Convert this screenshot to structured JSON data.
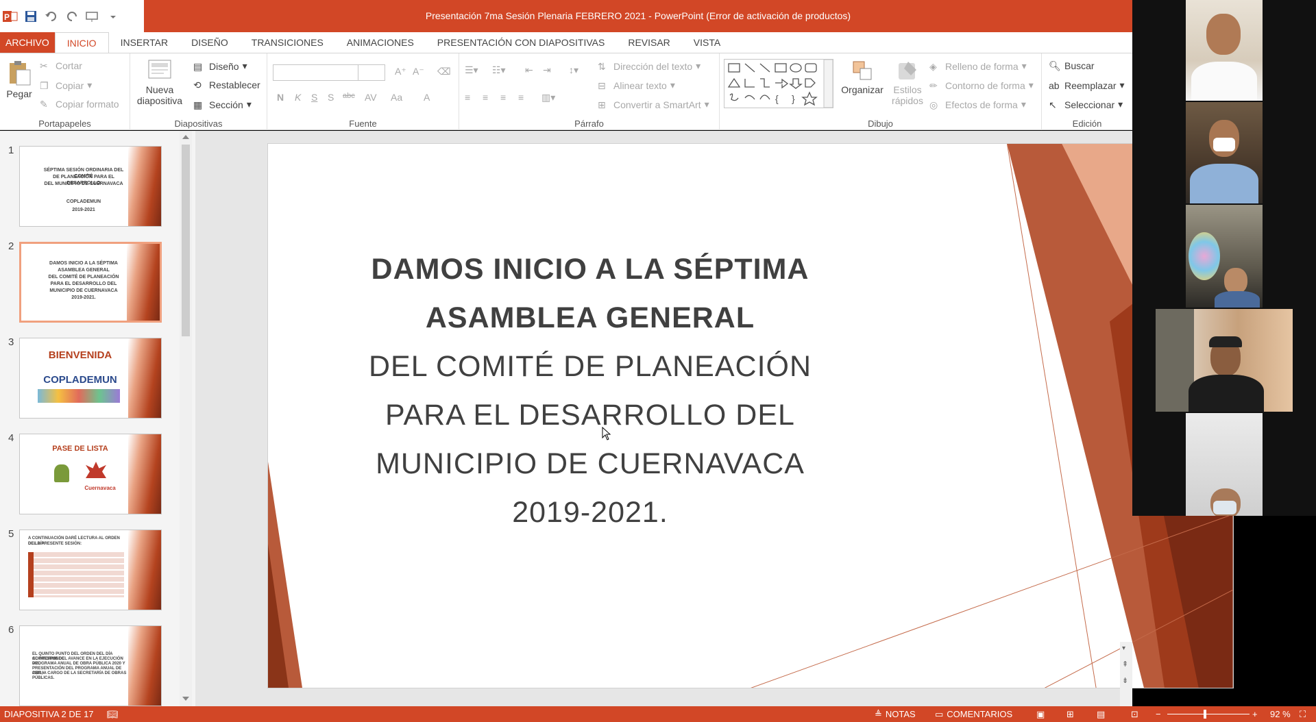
{
  "window": {
    "title": "Presentación 7ma Sesión Plenaria FEBRERO 2021 -  PowerPoint (Error de activación de productos)"
  },
  "tabs": [
    "ARCHIVO",
    "INICIO",
    "INSERTAR",
    "DISEÑO",
    "TRANSICIONES",
    "ANIMACIONES",
    "PRESENTACIÓN CON DIAPOSITIVAS",
    "REVISAR",
    "VISTA"
  ],
  "ribbon": {
    "clipboard": {
      "label": "Portapapeles",
      "paste": "Pegar",
      "cut": "Cortar",
      "copy": "Copiar",
      "format_painter": "Copiar formato"
    },
    "slides": {
      "label": "Diapositivas",
      "new_slide": "Nueva",
      "new_slide_2": "diapositiva",
      "layout": "Diseño",
      "reset": "Restablecer",
      "section": "Sección"
    },
    "font": {
      "label": "Fuente"
    },
    "paragraph": {
      "label": "Párrafo",
      "text_direction": "Dirección del texto",
      "align_text": "Alinear texto",
      "smartart": "Convertir a SmartArt"
    },
    "drawing": {
      "label": "Dibujo",
      "arrange": "Organizar",
      "quick_styles": "Estilos",
      "quick_styles_2": "rápidos",
      "shape_fill": "Relleno de forma",
      "shape_outline": "Contorno de forma",
      "shape_effects": "Efectos de forma"
    },
    "editing": {
      "label": "Edición",
      "find": "Buscar",
      "replace": "Reemplazar",
      "select": "Seleccionar"
    }
  },
  "thumbnails": [
    {
      "num": "1",
      "lines": [
        "SÉPTIMA SESIÓN ORDINARIA DEL COMITÉ",
        "DE PLANEACIÓN PARA EL DESARROLLO",
        "DEL MUNICIPIO DE CUERNAVACA",
        "",
        "COPLADEMUN",
        "2019-2021"
      ]
    },
    {
      "num": "2",
      "lines": [
        "DAMOS INICIO A LA SÉPTIMA",
        "ASAMBLEA GENERAL",
        "DEL COMITÉ DE PLANEACIÓN",
        "PARA EL DESARROLLO DEL",
        "MUNICIPIO DE CUERNAVACA",
        "2019-2021."
      ]
    },
    {
      "num": "3",
      "title": "BIENVENIDA",
      "logo": "COPLADEMUN"
    },
    {
      "num": "4",
      "title": "PASE DE LISTA",
      "logo": "Cuernavaca"
    },
    {
      "num": "5",
      "lines": [
        "A CONTINUACIÓN DARÉ LECTURA AL ORDEN DEL DÍA",
        "DE LA PRESENTE SESIÓN:"
      ]
    },
    {
      "num": "6",
      "lines": [
        "EL QUINTO PUNTO DEL ORDEN DEL DÍA CORRESPONDE",
        "AL INFORME DEL AVANCE EN LA EJECUCIÓN DEL",
        "PROGRAMA ANUAL DE OBRA PÚBLICA 2020 Y",
        "PRESENTACIÓN DEL PROGRAMA ANUAL DE OBRA",
        "2021, A CARGO DE LA SECRETARÍA DE OBRAS",
        "PÚBLICAS."
      ]
    }
  ],
  "slide": {
    "lines": [
      "DAMOS INICIO A LA SÉPTIMA",
      "ASAMBLEA GENERAL",
      "DEL COMITÉ DE PLANEACIÓN",
      "PARA EL DESARROLLO DEL",
      "MUNICIPIO DE CUERNAVACA",
      "2019-2021."
    ]
  },
  "statusbar": {
    "slide_info": "DIAPOSITIVA 2 DE 17",
    "notes": "NOTAS",
    "comments": "COMENTARIOS",
    "zoom": "92 %",
    "zoom_level": 0.46
  },
  "colors": {
    "accent": "#d24726",
    "slide_deco_dark": "#9e3a1b",
    "slide_deco_light": "#e8a889"
  }
}
